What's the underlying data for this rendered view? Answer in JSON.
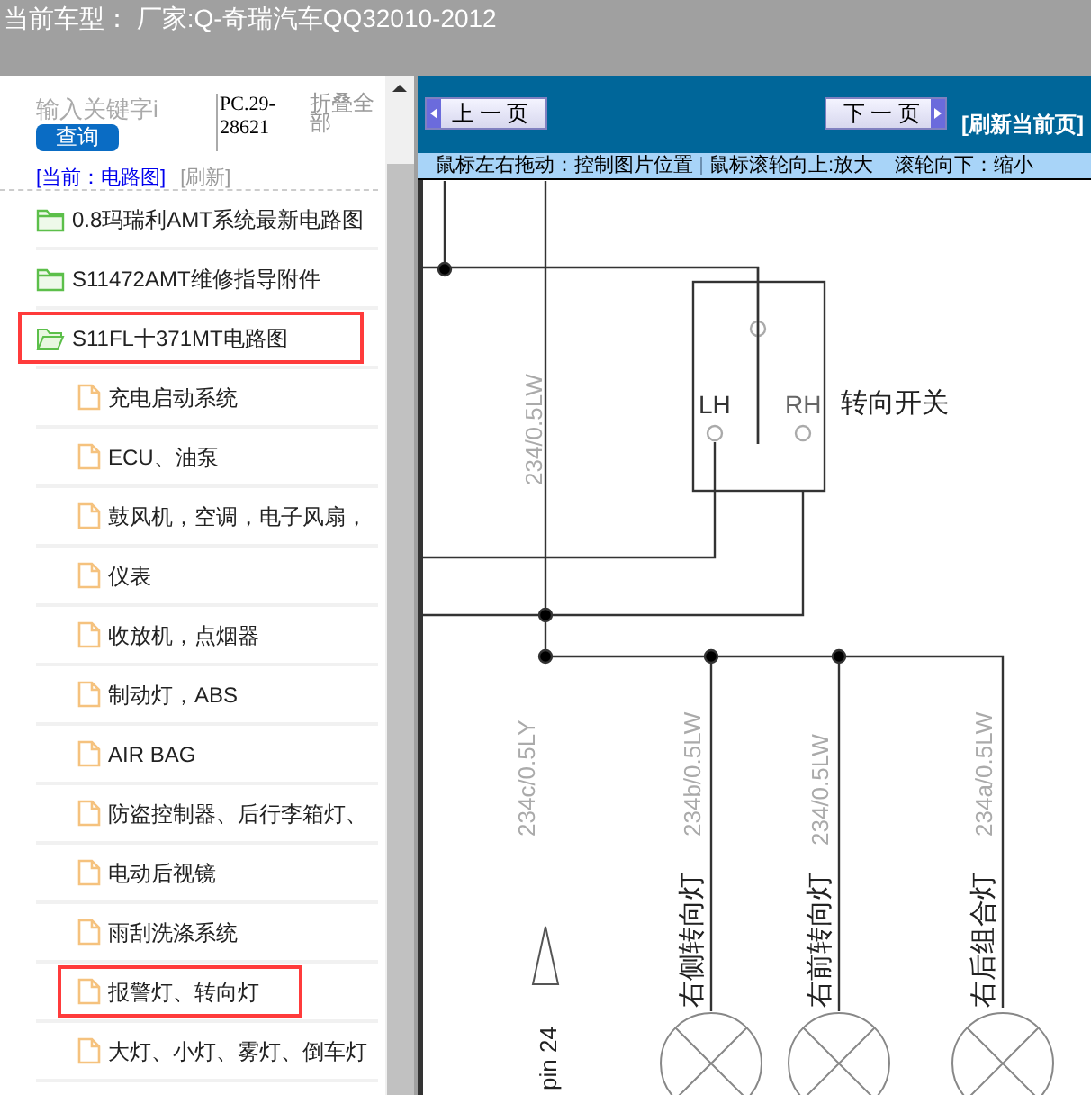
{
  "header": {
    "title": "当前车型： 厂家:Q-奇瑞汽车QQ32010-2012"
  },
  "sidebar": {
    "search": {
      "placeholder": "输入关键字i",
      "button": "查询"
    },
    "code": "PC.29-28621",
    "collapse_all": "折叠全部",
    "breadcrumb": "[当前：电路图]",
    "refresh": "[刷新]",
    "tree": [
      {
        "label": "0.8玛瑞利AMT系统最新电路图",
        "expanded": false,
        "highlighted": false
      },
      {
        "label": "S11472AMT维修指导附件",
        "expanded": false,
        "highlighted": false
      },
      {
        "label": "S11FL十371MT电路图",
        "expanded": true,
        "highlighted": true,
        "children": [
          {
            "label": "充电启动系统",
            "highlighted": false
          },
          {
            "label": "ECU、油泵",
            "highlighted": false
          },
          {
            "label": "鼓风机，空调，电子风扇，",
            "highlighted": false
          },
          {
            "label": "仪表",
            "highlighted": false
          },
          {
            "label": "收放机，点烟器",
            "highlighted": false
          },
          {
            "label": "制动灯，ABS",
            "highlighted": false
          },
          {
            "label": "AIR BAG",
            "highlighted": false
          },
          {
            "label": "防盗控制器、后行李箱灯、",
            "highlighted": false
          },
          {
            "label": "电动后视镜",
            "highlighted": false
          },
          {
            "label": "雨刮洗涤系统",
            "highlighted": false
          },
          {
            "label": "报警灯、转向灯",
            "highlighted": true
          },
          {
            "label": "大灯、小灯、雾灯、倒车灯",
            "highlighted": false
          }
        ]
      }
    ]
  },
  "viewer": {
    "prev": "上 一 页",
    "next": "下 一 页",
    "refresh": "[刷新当前页]",
    "hints": [
      "鼠标左右拖动：控制图片位置",
      "鼠标滚轮向上:放大",
      "滚轮向下：缩小"
    ],
    "diagram": {
      "main_wire_label": "234/0.5LW",
      "switch": {
        "label": "转向开关",
        "left": "LH",
        "right": "RH"
      },
      "branches": [
        {
          "kind": "pin",
          "wire_label": "234c/0.5LY",
          "label": "pin 24"
        },
        {
          "kind": "lamp",
          "wire_label": "234b/0.5LW",
          "label": "右侧转向灯"
        },
        {
          "kind": "lamp",
          "wire_label": "234/0.5LW",
          "label": "右前转向灯"
        },
        {
          "kind": "lamp",
          "wire_label": "234a/0.5LW",
          "label": "右后组合灯"
        }
      ]
    }
  }
}
